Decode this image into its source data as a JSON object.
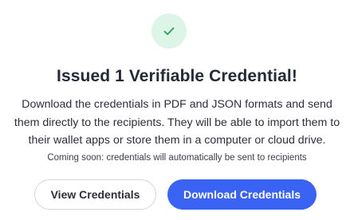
{
  "dialog": {
    "title": "Issued 1 Verifiable Credential!",
    "description_lines": [
      "Download the credentials in PDF and JSON formats and send",
      "them directly to the recipients. They will be able to import them to",
      "their wallet apps or store them in a computer or cloud drive."
    ],
    "note": "Coming soon: credentials will automatically be sent to recipients",
    "success_icon": "check-icon",
    "buttons": {
      "view_label": "View Credentials",
      "download_label": "Download Credentials"
    },
    "colors": {
      "success_circle_bg": "#dcf5e6",
      "check": "#2e9e5b",
      "primary": "#3b63f3",
      "text": "#262a36"
    }
  }
}
